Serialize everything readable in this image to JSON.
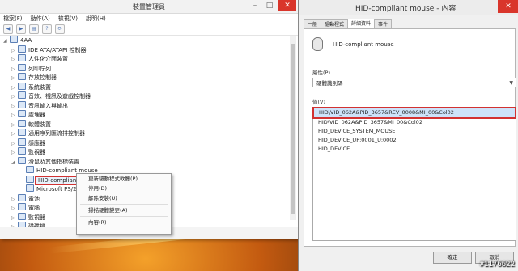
{
  "device_manager": {
    "title": "裝置管理員",
    "menu": [
      "檔案(F)",
      "動作(A)",
      "檢視(V)",
      "說明(H)"
    ],
    "tree": [
      {
        "label": "4AA",
        "arrow": "◢",
        "indent": 0
      },
      {
        "label": "IDE ATA/ATAPI 控制器",
        "arrow": "▷",
        "indent": 1
      },
      {
        "label": "人性化介面裝置",
        "arrow": "▷",
        "indent": 1
      },
      {
        "label": "列印佇列",
        "arrow": "▷",
        "indent": 1
      },
      {
        "label": "存放控制器",
        "arrow": "▷",
        "indent": 1
      },
      {
        "label": "系統裝置",
        "arrow": "▷",
        "indent": 1
      },
      {
        "label": "音效、視訊及遊戲控制器",
        "arrow": "▷",
        "indent": 1
      },
      {
        "label": "音訊輸入與輸出",
        "arrow": "▷",
        "indent": 1
      },
      {
        "label": "處理器",
        "arrow": "▷",
        "indent": 1
      },
      {
        "label": "軟體裝置",
        "arrow": "▷",
        "indent": 1
      },
      {
        "label": "通用序列匯流排控制器",
        "arrow": "▷",
        "indent": 1
      },
      {
        "label": "感應器",
        "arrow": "▷",
        "indent": 1
      },
      {
        "label": "監視器",
        "arrow": "▷",
        "indent": 1
      },
      {
        "label": "滑鼠及其他指標裝置",
        "arrow": "◢",
        "indent": 1
      },
      {
        "label": "HID-compliant mouse",
        "arrow": "",
        "indent": 2
      },
      {
        "label": "HID-compliant mouse",
        "arrow": "",
        "indent": 2,
        "highlight": true
      },
      {
        "label": "Microsoft PS/2",
        "arrow": "",
        "indent": 2
      },
      {
        "label": "電池",
        "arrow": "▷",
        "indent": 1
      },
      {
        "label": "電腦",
        "arrow": "▷",
        "indent": 1
      },
      {
        "label": "監視器",
        "arrow": "▷",
        "indent": 1
      },
      {
        "label": "磁碟機",
        "arrow": "▷",
        "indent": 1
      }
    ]
  },
  "context_menu": {
    "items": [
      "更新驅動程式軟體(P)...",
      "停用(D)",
      "解除安裝(U)",
      "掃描硬體變更(A)",
      "內容(R)"
    ]
  },
  "properties": {
    "title": "HID-compliant mouse - 內容",
    "tabs": [
      "一般",
      "驅動程式",
      "詳細資料",
      "事件"
    ],
    "active_tab": 2,
    "device_name": "HID-compliant mouse",
    "property_label": "屬性(P)",
    "property_value": "硬體識別碼",
    "value_label": "值(V)",
    "values": [
      "HID\\VID_062A&PID_3657&REV_0008&MI_00&Col02",
      "HID\\VID_062A&PID_3657&MI_00&Col02",
      "HID_DEVICE_SYSTEM_MOUSE",
      "HID_DEVICE_UP:0001_U:0002",
      "HID_DEVICE"
    ],
    "ok_label": "確定",
    "cancel_label": "取消"
  },
  "watermark": "#1176622"
}
